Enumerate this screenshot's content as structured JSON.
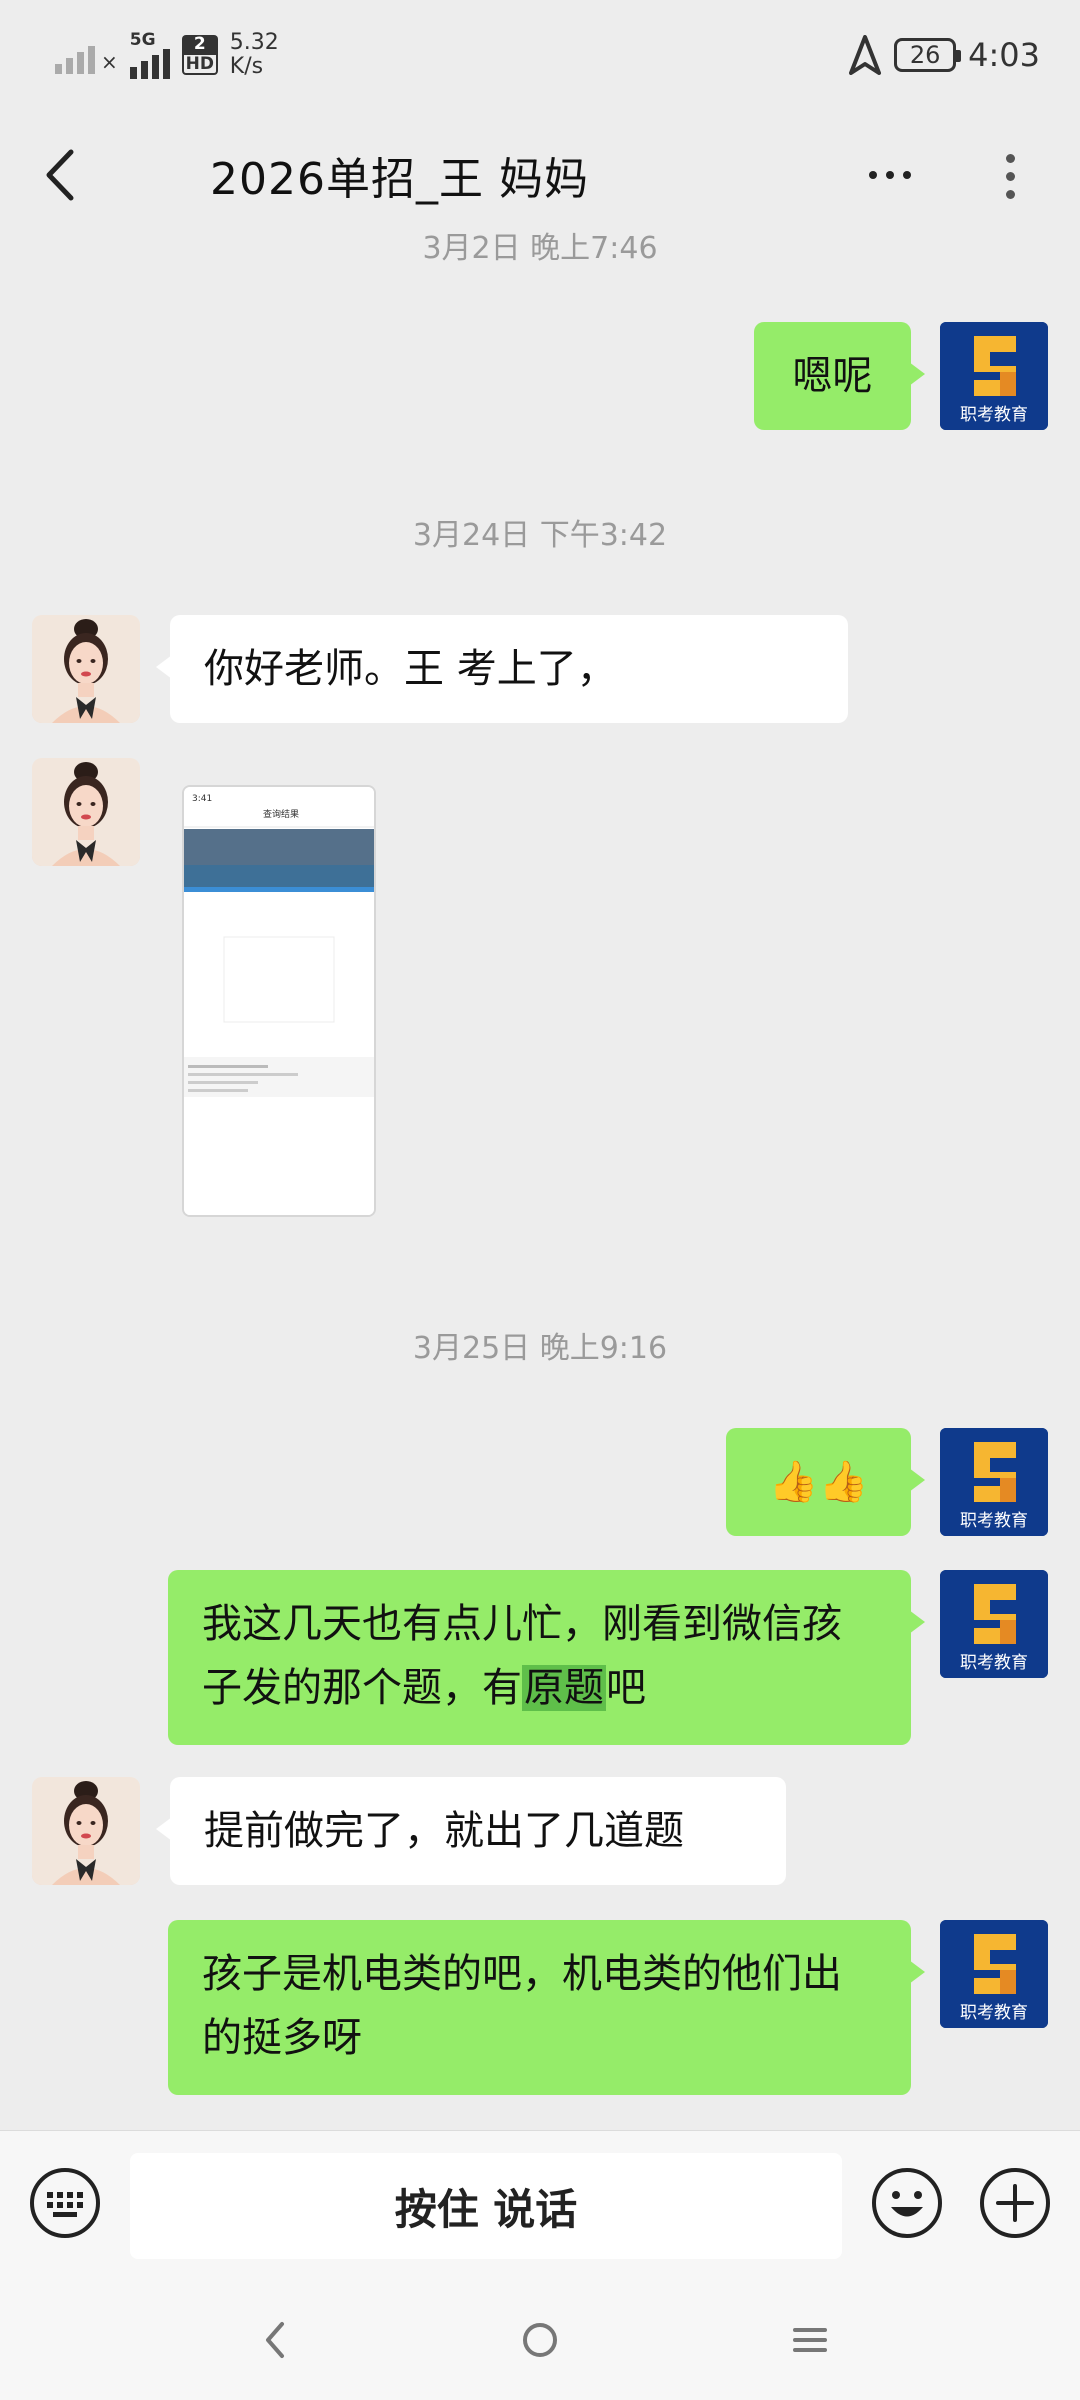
{
  "status_bar": {
    "net_5g": "5G",
    "sim2": "2",
    "hd": "HD",
    "speed_value": "5.32",
    "speed_unit": "K/s",
    "battery": "26",
    "time": "4:03"
  },
  "header": {
    "title": "2026单招_王   妈妈"
  },
  "messages": {
    "ts_top": "3月2日 晚上7:46",
    "m1_out": "嗯呢",
    "ts_2": "3月24日 下午3:42",
    "m2_in": "你好老师。王     考上了，",
    "ts_3": "3月25日 晚上9:16",
    "m4_out": "👍👍",
    "m5_out_a": "我这几天也有点儿忙，刚看到微信孩子发的那个题，有",
    "m5_out_hl": "原题",
    "m5_out_b": "吧",
    "m6_in": "提前做完了，就出了几道题",
    "m7_out": "孩子是机电类的吧，机电类的他们出的挺多呀"
  },
  "avatar_logo_text": "职考教育",
  "thumbnail": {
    "time": "3:41",
    "title": "查询结果"
  },
  "input_bar": {
    "voice_label": "按住 说话"
  },
  "icons": {
    "back": "chevron-left-icon",
    "more": "more-dots-icon",
    "kebab": "kebab-icon",
    "keyboard": "keyboard-icon",
    "emoji": "smiley-icon",
    "plus": "plus-icon"
  }
}
